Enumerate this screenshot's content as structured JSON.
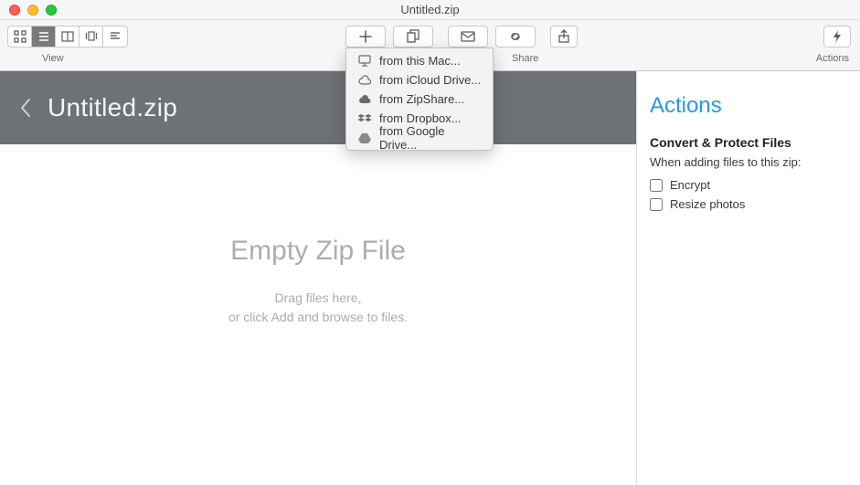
{
  "window": {
    "title": "Untitled.zip"
  },
  "toolbar": {
    "view_label": "View",
    "share_label": "Share",
    "actions_label": "Actions"
  },
  "dropdown": {
    "items": [
      {
        "label": "from this Mac..."
      },
      {
        "label": "from iCloud Drive..."
      },
      {
        "label": "from ZipShare..."
      },
      {
        "label": "from Dropbox..."
      },
      {
        "label": "from Google Drive..."
      }
    ]
  },
  "header": {
    "filename": "Untitled.zip"
  },
  "dropzone": {
    "title": "Empty Zip File",
    "line1": "Drag files here,",
    "line2": "or click Add and browse to files."
  },
  "sidebar": {
    "title": "Actions",
    "section_title": "Convert & Protect Files",
    "section_subtitle": "When adding files to this zip:",
    "encrypt_label": "Encrypt",
    "resize_label": "Resize photos"
  }
}
